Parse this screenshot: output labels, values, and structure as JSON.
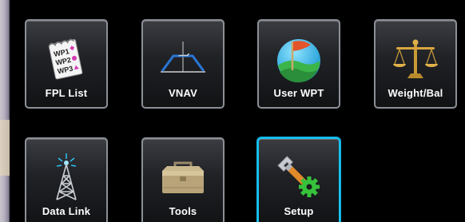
{
  "buttons": [
    {
      "label": "FPL List",
      "icon": "flight-plan-list-icon",
      "selected": false
    },
    {
      "label": "VNAV",
      "icon": "vertical-profile-icon",
      "selected": false
    },
    {
      "label": "User WPT",
      "icon": "user-waypoint-flag-icon",
      "selected": false
    },
    {
      "label": "Weight/Bal",
      "icon": "balance-scale-icon",
      "selected": false
    },
    {
      "label": "Data Link",
      "icon": "radio-tower-icon",
      "selected": false
    },
    {
      "label": "Tools",
      "icon": "toolbox-icon",
      "selected": false
    },
    {
      "label": "Setup",
      "icon": "wrench-gear-icon",
      "selected": true
    }
  ],
  "fpl_icon_lines": [
    "WP1",
    "WP2",
    "WP3"
  ],
  "colors": {
    "selected_border": "#18c3f2",
    "tile_border": "#8b8f96",
    "label_text": "#ffffff",
    "background": "#000000"
  }
}
